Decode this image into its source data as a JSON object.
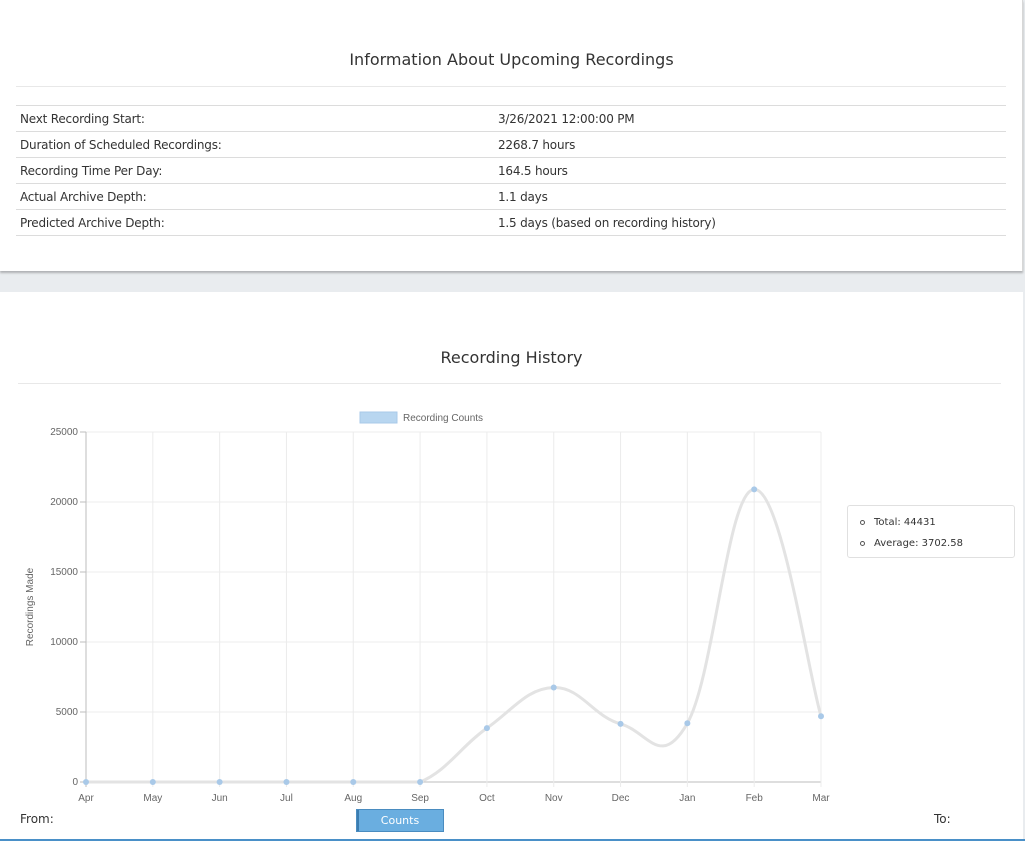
{
  "upcoming": {
    "title": "Information About Upcoming Recordings",
    "rows": [
      {
        "label": "Next Recording Start:",
        "value": "3/26/2021 12:00:00 PM"
      },
      {
        "label": "Duration of Scheduled Recordings:",
        "value": "2268.7 hours"
      },
      {
        "label": "Recording Time Per Day:",
        "value": "164.5 hours"
      },
      {
        "label": "Actual Archive Depth:",
        "value": "1.1 days"
      },
      {
        "label": "Predicted Archive Depth:",
        "value": "1.5 days (based on recording history)"
      }
    ]
  },
  "history": {
    "title": "Recording History",
    "summary": {
      "total": "Total: 44431",
      "average": "Average: 3702.58"
    },
    "from_label": "From:",
    "to_label": "To:",
    "counts_button": "Counts"
  },
  "colors": {
    "accent": "#6aaee0",
    "line": "#e3e3e3",
    "point": "#a9c9e8",
    "legend_swatch": "#b8d6f0"
  },
  "chart_data": {
    "type": "line",
    "categories": [
      "Apr",
      "May",
      "Jun",
      "Jul",
      "Aug",
      "Sep",
      "Oct",
      "Nov",
      "Dec",
      "Jan",
      "Feb",
      "Mar"
    ],
    "series": [
      {
        "name": "Recording Counts",
        "values": [
          0,
          0,
          0,
          0,
          0,
          0,
          3850,
          6750,
          4150,
          4200,
          20900,
          4700
        ]
      }
    ],
    "ylabel": "Recordings Made",
    "xlabel": "",
    "ylim": [
      0,
      25000
    ],
    "yticks": [
      0,
      5000,
      10000,
      15000,
      20000,
      25000
    ],
    "grid": true,
    "legend": "top"
  }
}
